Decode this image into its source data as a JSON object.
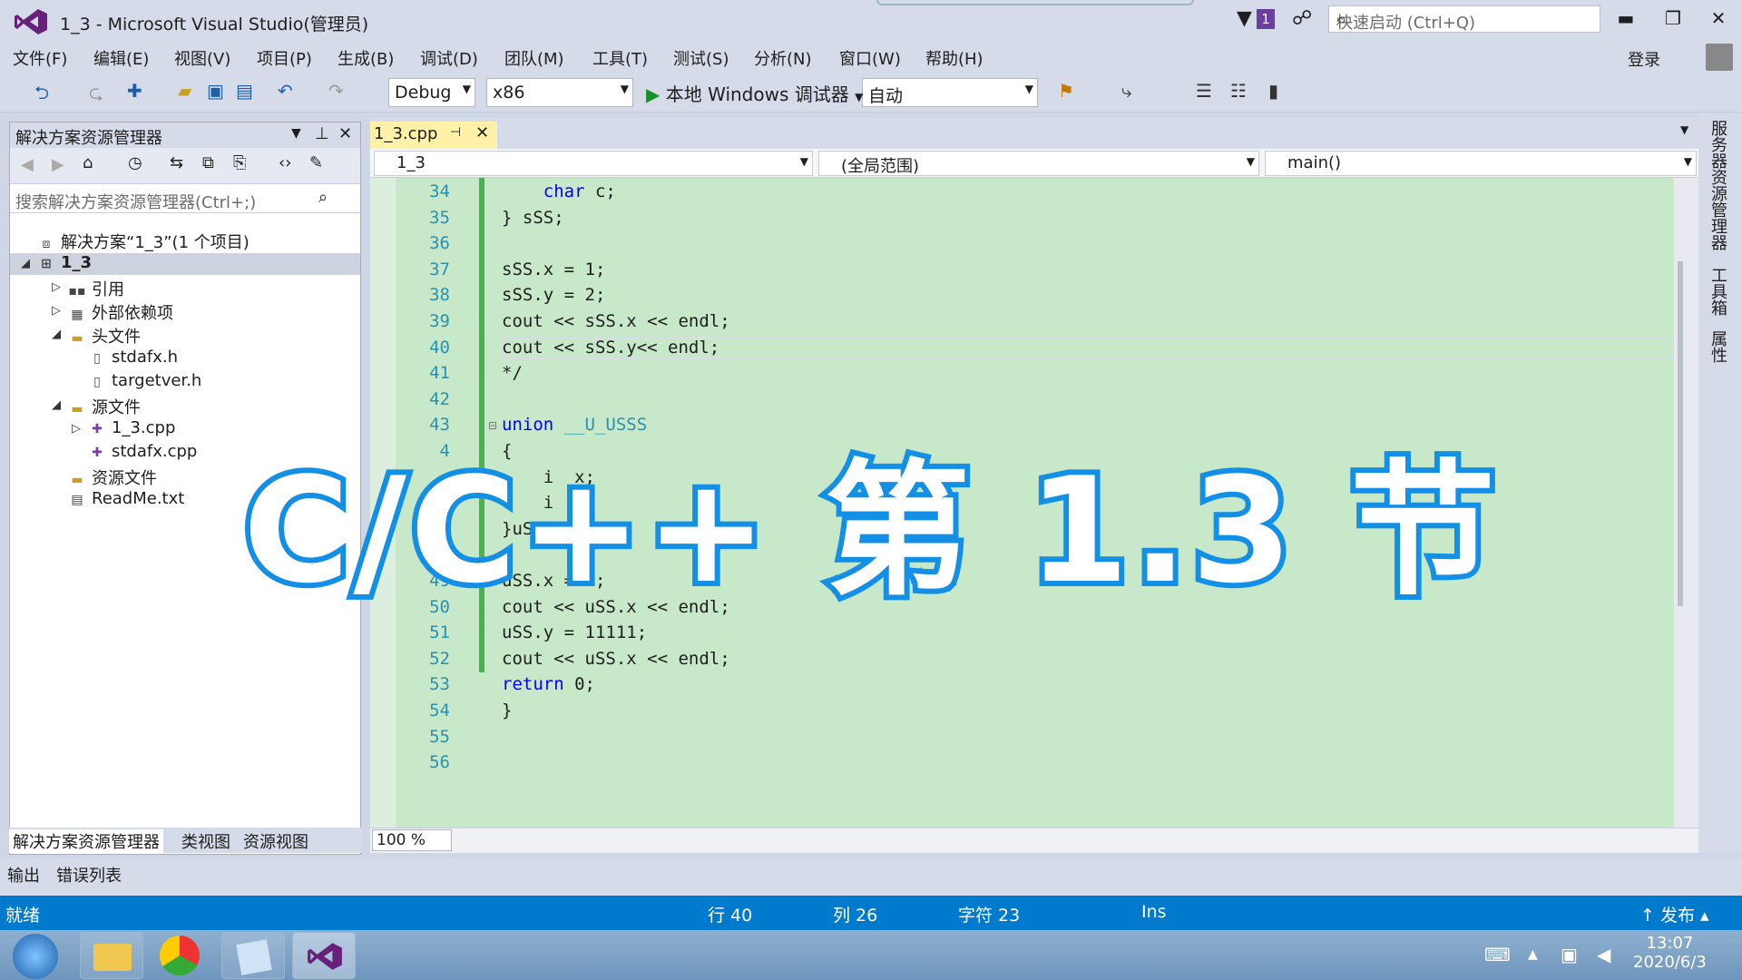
{
  "window": {
    "title": "1_3 - Microsoft Visual Studio(管理员)",
    "badge": "1",
    "quick_launch_placeholder": "快速启动 (Ctrl+Q)",
    "login": "登录",
    "minimize": "▬",
    "restore": "❐",
    "close": "✕"
  },
  "menu": [
    "文件(F)",
    "编辑(E)",
    "视图(V)",
    "项目(P)",
    "生成(B)",
    "调试(D)",
    "团队(M)",
    "工具(T)",
    "测试(S)",
    "分析(N)",
    "窗口(W)",
    "帮助(H)"
  ],
  "toolbar": {
    "config": "Debug",
    "platform": "x86",
    "run_label": "本地 Windows 调试器",
    "auto": "自动"
  },
  "solution_explorer": {
    "title": "解决方案资源管理器",
    "search_placeholder": "搜索解决方案资源管理器(Ctrl+;)",
    "items": [
      {
        "label": "解决方案“1_3”(1 个项目)",
        "icon": "solution-icon",
        "level": 0,
        "expander": ""
      },
      {
        "label": "1_3",
        "icon": "project-icon",
        "level": 0,
        "expander": "◢",
        "bold": true
      },
      {
        "label": "引用",
        "icon": "reference-icon",
        "level": 1,
        "expander": "▷"
      },
      {
        "label": "外部依赖项",
        "icon": "dependency-icon",
        "level": 1,
        "expander": "▷"
      },
      {
        "label": "头文件",
        "icon": "folder-icon",
        "level": 1,
        "expander": "◢"
      },
      {
        "label": "stdafx.h",
        "icon": "header-file-icon",
        "level": 2,
        "expander": ""
      },
      {
        "label": "targetver.h",
        "icon": "header-file-icon",
        "level": 2,
        "expander": ""
      },
      {
        "label": "源文件",
        "icon": "folder-icon",
        "level": 1,
        "expander": "◢"
      },
      {
        "label": "1_3.cpp",
        "icon": "cpp-file-icon",
        "level": 2,
        "expander": "▷"
      },
      {
        "label": "stdafx.cpp",
        "icon": "cpp-file-icon",
        "level": 2,
        "expander": ""
      },
      {
        "label": "资源文件",
        "icon": "folder-icon",
        "level": 1,
        "expander": ""
      },
      {
        "label": "ReadMe.txt",
        "icon": "text-file-icon",
        "level": 1,
        "expander": ""
      }
    ],
    "tabs": [
      "解决方案资源管理器",
      "类视图",
      "资源视图"
    ]
  },
  "editor": {
    "tab": "1_3.cpp",
    "nav_project": "1_3",
    "nav_scope": "(全局范围)",
    "nav_member": "main()",
    "zoom": "100 %",
    "lines": [
      {
        "n": "34",
        "code": "    char c;"
      },
      {
        "n": "35",
        "code": "} sSS;"
      },
      {
        "n": "36",
        "code": ""
      },
      {
        "n": "37",
        "code": "sSS.x = 1;"
      },
      {
        "n": "38",
        "code": "sSS.y = 2;"
      },
      {
        "n": "39",
        "code": "cout << sSS.x << endl;"
      },
      {
        "n": "40",
        "code": "cout << sSS.y<< endl;"
      },
      {
        "n": "41",
        "code": "*/"
      },
      {
        "n": "42",
        "code": ""
      },
      {
        "n": "43",
        "code": "union __U_USSS"
      },
      {
        "n": "4",
        "code": "{"
      },
      {
        "n": "",
        "code": "    i  x;"
      },
      {
        "n": "",
        "code": "    i  y;"
      },
      {
        "n": "47",
        "code": "}uSS;"
      },
      {
        "n": "48",
        "code": ""
      },
      {
        "n": "49",
        "code": "uSS.x = 1;"
      },
      {
        "n": "50",
        "code": "cout << uSS.x << endl;"
      },
      {
        "n": "51",
        "code": "uSS.y = 11111;"
      },
      {
        "n": "52",
        "code": "cout << uSS.x << endl;"
      },
      {
        "n": "53",
        "code": "return 0;"
      },
      {
        "n": "54",
        "code": "}"
      },
      {
        "n": "55",
        "code": ""
      },
      {
        "n": "56",
        "code": ""
      }
    ]
  },
  "overlay_title": "C/C++ 第 1.3 节",
  "right_tabs": [
    "服务器资源管理器",
    "工具箱",
    "属性"
  ],
  "output_tabs": [
    "输出",
    "错误列表"
  ],
  "status": {
    "ready": "就绪",
    "row": "行 40",
    "col": "列 26",
    "char": "字符 23",
    "ins": "Ins",
    "publish": "↑ 发布 ▴"
  },
  "taskbar": {
    "time": "13:07",
    "date": "2020/6/3"
  }
}
